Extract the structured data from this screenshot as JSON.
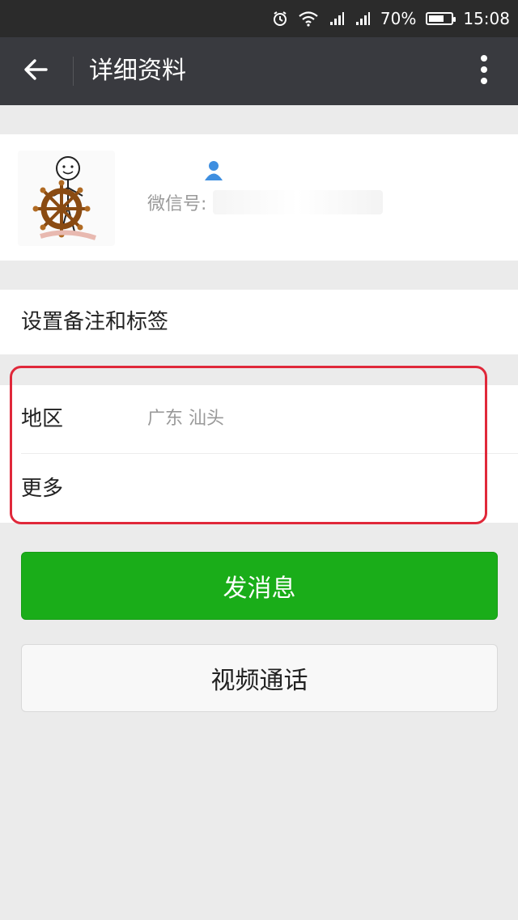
{
  "status_bar": {
    "battery_percent": "70%",
    "battery_level": 0.7,
    "time": "15:08",
    "icons": [
      "alarm-icon",
      "wifi-icon",
      "signal-icon",
      "signal-icon",
      "battery-icon"
    ]
  },
  "app_bar": {
    "title": "详细资料",
    "back_icon": "arrow-left-icon",
    "menu_icon": "more-vertical-icon"
  },
  "profile": {
    "avatar_icon": "stickman-ship-wheel-avatar",
    "contact_icon": "person-icon",
    "wechat_id_label": "微信号: "
  },
  "tag_section": {
    "label": "设置备注和标签"
  },
  "info_section": {
    "region_label": "地区",
    "region_value": "广东  汕头",
    "more_label": "更多"
  },
  "actions": {
    "send_message": "发消息",
    "video_call": "视频通话"
  },
  "colors": {
    "app_bar": "#393a3f",
    "status_bar": "#2b2b2b",
    "send_button": "#1aad19",
    "highlight": "#e0283a",
    "page_bg": "#ebebeb"
  }
}
